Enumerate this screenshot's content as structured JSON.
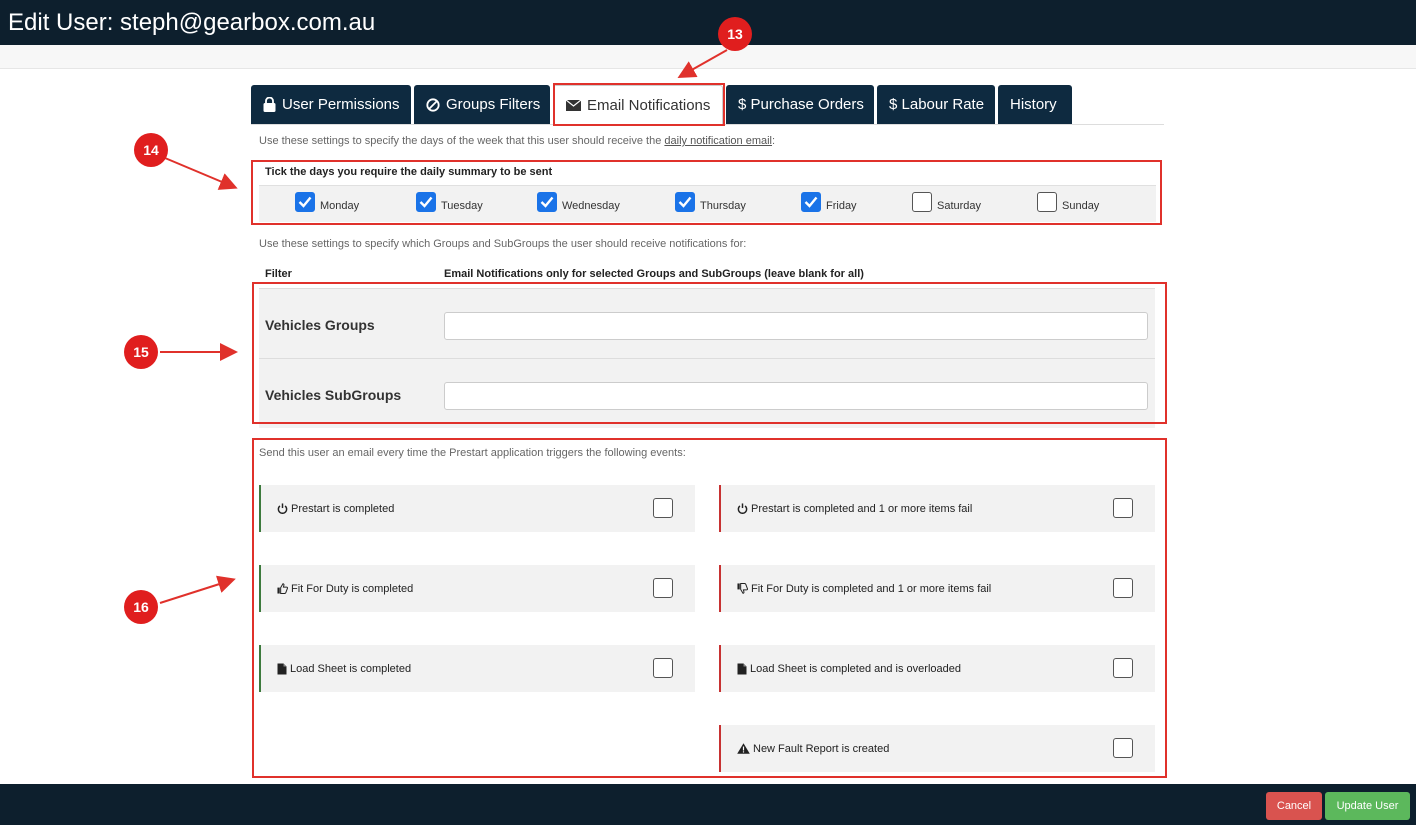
{
  "header": {
    "title": "Edit User: steph@gearbox.com.au"
  },
  "tabs": [
    {
      "label": "User Permissions",
      "icon": "lock-icon"
    },
    {
      "label": "Groups Filters",
      "icon": "ban-icon"
    },
    {
      "label": "Email Notifications",
      "icon": "envelope-icon",
      "active": true
    },
    {
      "label": "$ Purchase Orders"
    },
    {
      "label": "$ Labour Rate"
    },
    {
      "label": "History"
    }
  ],
  "days_section": {
    "intro_prefix": "Use these settings to specify the days of the week that this user should receive the ",
    "intro_link": "daily notification email",
    "intro_suffix": ":",
    "title": "Tick the days you require the daily summary to be sent",
    "days": [
      {
        "label": "Monday",
        "checked": true
      },
      {
        "label": "Tuesday",
        "checked": true
      },
      {
        "label": "Wednesday",
        "checked": true
      },
      {
        "label": "Thursday",
        "checked": true
      },
      {
        "label": "Friday",
        "checked": true
      },
      {
        "label": "Saturday",
        "checked": false
      },
      {
        "label": "Sunday",
        "checked": false
      }
    ]
  },
  "groups_section": {
    "intro": "Use these settings to specify which Groups and SubGroups the user should receive notifications for:",
    "col_filter": "Filter",
    "col_notifications": "Email Notifications only for selected Groups and SubGroups (leave blank for all)",
    "rows": [
      {
        "label": "Vehicles Groups",
        "value": ""
      },
      {
        "label": "Vehicles SubGroups",
        "value": ""
      }
    ]
  },
  "events_section": {
    "intro": "Send this user an email every time the Prestart application triggers the following events:",
    "left": [
      {
        "label": "Prestart is completed",
        "icon": "power-icon",
        "checked": false
      },
      {
        "label": "Fit For Duty is completed",
        "icon": "thumbs-up-icon",
        "checked": false
      },
      {
        "label": "Load Sheet is completed",
        "icon": "file-icon",
        "checked": false
      }
    ],
    "right": [
      {
        "label": "Prestart is completed and 1 or more items fail",
        "icon": "power-icon",
        "checked": false
      },
      {
        "label": "Fit For Duty is completed and 1 or more items fail",
        "icon": "thumbs-down-icon",
        "checked": false
      },
      {
        "label": "Load Sheet is completed and is overloaded",
        "icon": "file-icon",
        "checked": false
      },
      {
        "label": "New Fault Report is created",
        "icon": "warning-icon",
        "checked": false
      }
    ]
  },
  "annotations": {
    "a13": "13",
    "a14": "14",
    "a15": "15",
    "a16": "16"
  },
  "footer": {
    "cancel_label": "Cancel",
    "update_label": "Update User"
  },
  "colors": {
    "header_bg": "#0d1f2d",
    "tab_bg": "#0e2a40",
    "checkbox_on": "#1a73e8",
    "annotation_red": "#e0312b",
    "cancel": "#d9534f",
    "update": "#5cb85c"
  }
}
